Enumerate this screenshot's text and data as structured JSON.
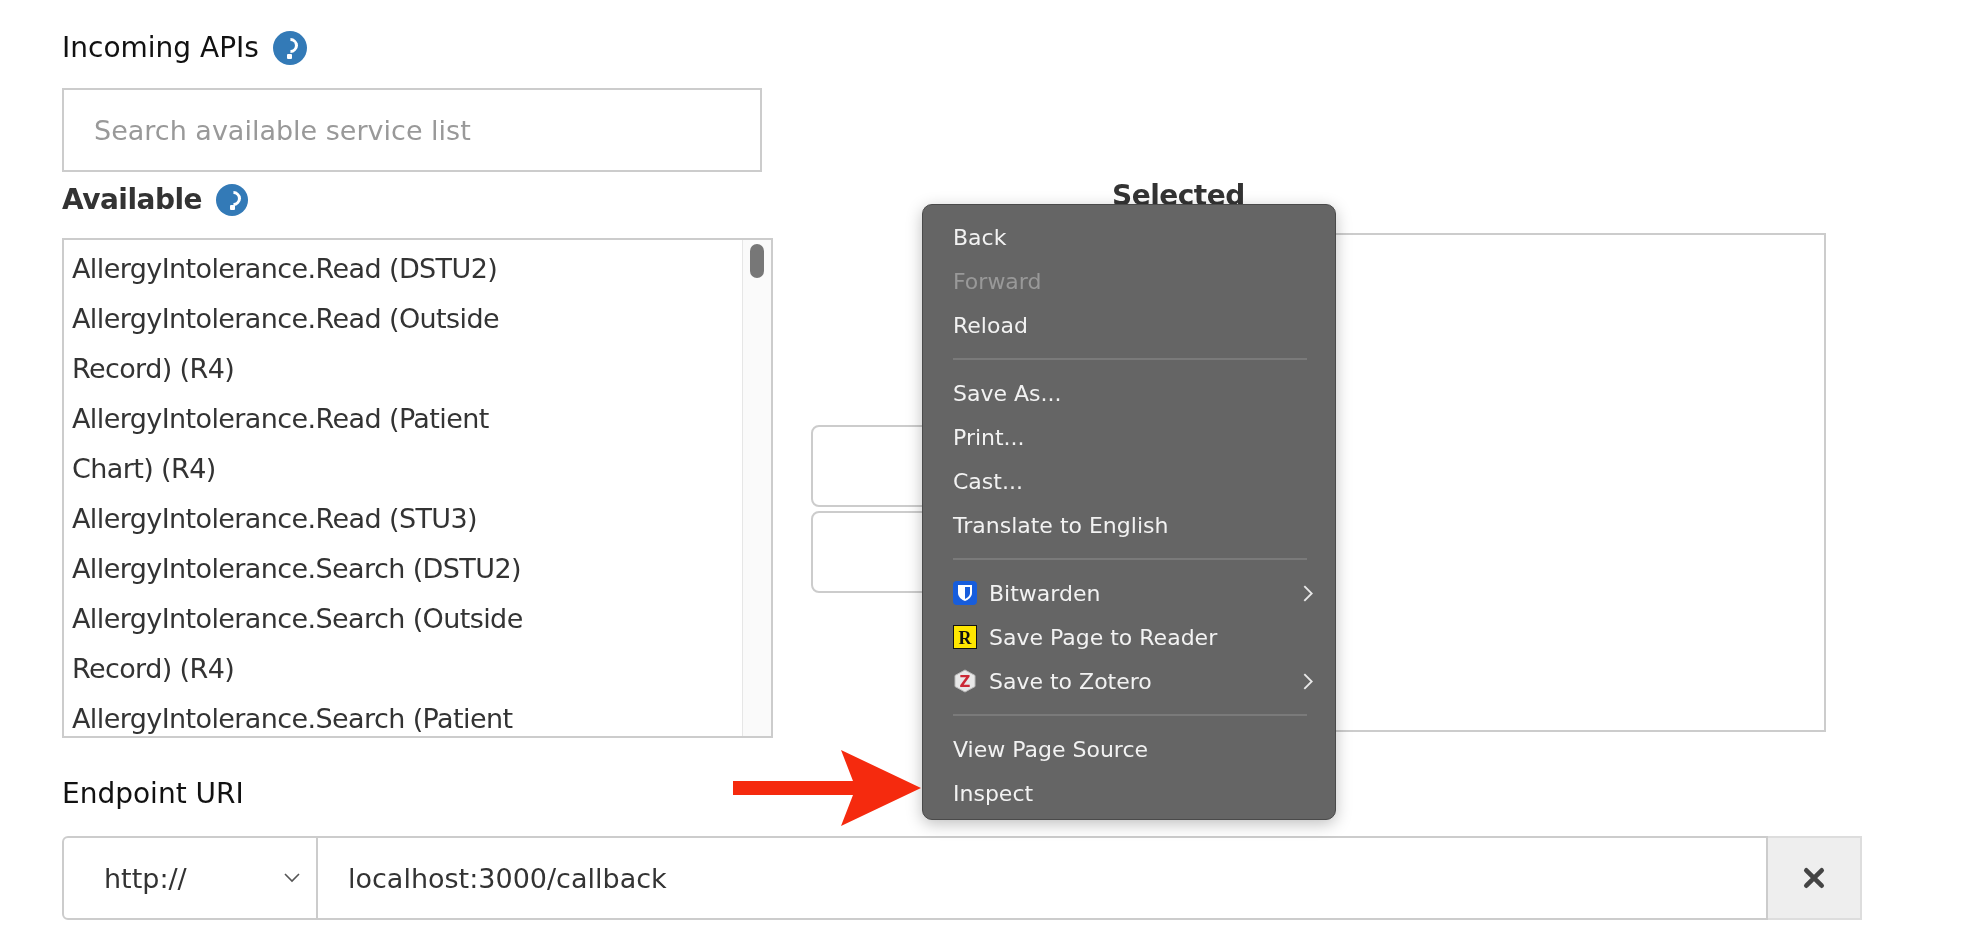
{
  "incoming_apis": {
    "title": "Incoming APIs",
    "search": {
      "placeholder": "Search available service list"
    }
  },
  "available": {
    "title": "Available",
    "items": [
      {
        "label": "AllergyIntolerance.Read (DSTU2)",
        "selected": false
      },
      {
        "label": "AllergyIntolerance.Read (Outside Record) (R4)",
        "selected": false
      },
      {
        "label": "AllergyIntolerance.Read (Patient Chart) (R4)",
        "selected": false
      },
      {
        "label": "AllergyIntolerance.Read (STU3)",
        "selected": false
      },
      {
        "label": "AllergyIntolerance.Search (DSTU2)",
        "selected": false
      },
      {
        "label": "AllergyIntolerance.Search (Outside Record) (R4)",
        "selected": false
      },
      {
        "label": "AllergyIntolerance.Search (Patient",
        "selected": false
      }
    ]
  },
  "selected": {
    "title": "Selected"
  },
  "context_menu": {
    "items": [
      {
        "kind": "item",
        "label": "Back",
        "disabled": false
      },
      {
        "kind": "item",
        "label": "Forward",
        "disabled": true
      },
      {
        "kind": "item",
        "label": "Reload",
        "disabled": false
      },
      {
        "kind": "separator"
      },
      {
        "kind": "item",
        "label": "Save As...",
        "disabled": false
      },
      {
        "kind": "item",
        "label": "Print...",
        "disabled": false
      },
      {
        "kind": "item",
        "label": "Cast...",
        "disabled": false
      },
      {
        "kind": "item",
        "label": "Translate to English",
        "disabled": false
      },
      {
        "kind": "separator"
      },
      {
        "kind": "shield_item",
        "label": "Bitwarden",
        "disabled": false,
        "submenu": true
      },
      {
        "kind": "reader_item",
        "label": "Save Page to Reader",
        "disabled": false,
        "icon_letter": "R",
        "submenu": false
      },
      {
        "kind": "zotero_item",
        "label": "Save to Zotero",
        "disabled": false,
        "icon_letter": "Z",
        "submenu": true
      },
      {
        "kind": "separator"
      },
      {
        "kind": "item",
        "label": "View Page Source",
        "disabled": false
      },
      {
        "kind": "item",
        "label": "Inspect",
        "disabled": false
      }
    ]
  },
  "endpoint_uri": {
    "title": "Endpoint URI",
    "scheme": "http://",
    "value": "localhost:3000/callback"
  }
}
